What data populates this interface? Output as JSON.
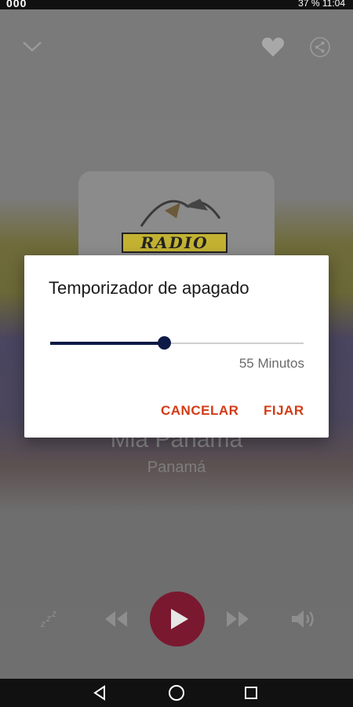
{
  "status_bar": {
    "left": "000",
    "battery": "37 %",
    "time": "11:04"
  },
  "now_playing": {
    "station_title": "Mia Panama",
    "country": "Panamá",
    "art_text": "RADIO"
  },
  "dialog": {
    "title": "Temporizador de apagado",
    "slider_fraction": 0.45,
    "value_text": "55 Minutos",
    "cancel_label": "CANCELAR",
    "set_label": "FIJAR"
  },
  "colors": {
    "accent": "#d33b16",
    "slider": "#0e1a46",
    "play_button": "#7a1830"
  },
  "icons": [
    "chevron-down-icon",
    "heart-icon",
    "share-icon",
    "sleep-icon",
    "rewind-icon",
    "play-icon",
    "fast-forward-icon",
    "volume-icon",
    "back-icon",
    "home-icon",
    "recents-icon"
  ]
}
